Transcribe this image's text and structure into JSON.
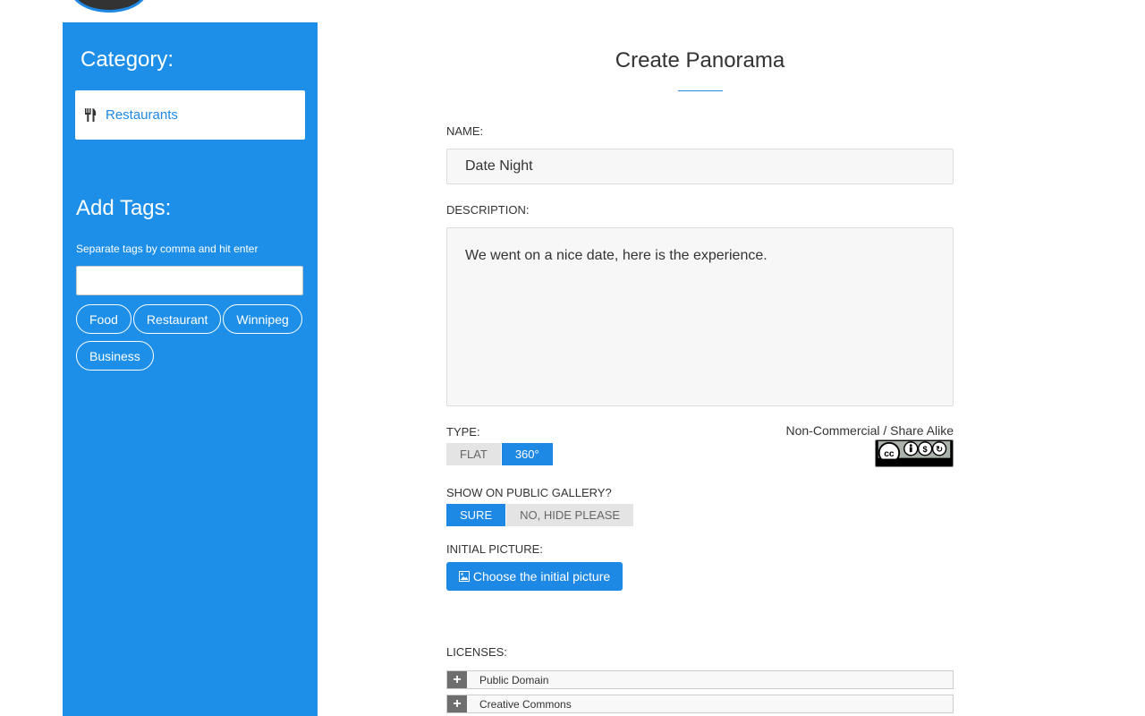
{
  "sidebar": {
    "category_heading": "Category:",
    "category_item": {
      "label": "Restaurants",
      "icon": "utensils-icon"
    },
    "tags_heading": "Add Tags:",
    "tags_hint": "Separate tags by comma and hit enter",
    "tag_input_value": "",
    "tags": [
      "Food",
      "Restaurant",
      "Winnipeg",
      "Business"
    ]
  },
  "form": {
    "title": "Create Panorama",
    "name_label": "NAME:",
    "name_value": "Date Night",
    "description_label": "DESCRIPTION:",
    "description_value": "We went on a nice date, here is the experience.",
    "type_label": "TYPE:",
    "type_options": [
      "FLAT",
      "360°"
    ],
    "type_selected": "360°",
    "license_text": "Non-Commercial / Share Alike",
    "gallery_label": "SHOW ON PUBLIC GALLERY?",
    "gallery_options": [
      "SURE",
      "NO, HIDE PLEASE"
    ],
    "gallery_selected": "SURE",
    "initial_picture_label": "INITIAL PICTURE:",
    "choose_button": "Choose the initial picture",
    "licenses_label": "LICENSES:",
    "licenses": [
      "Public Domain",
      "Creative Commons"
    ]
  },
  "colors": {
    "accent": "#1e88e5",
    "sidebar": "#1e8fe9"
  }
}
